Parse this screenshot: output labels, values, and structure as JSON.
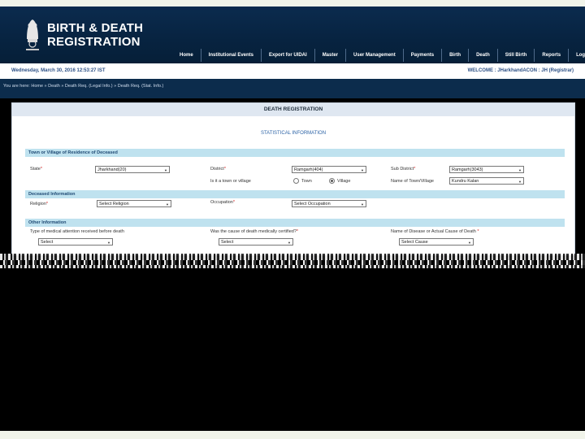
{
  "brand": {
    "line1": "BIRTH & DEATH",
    "line2": "REGISTRATION"
  },
  "nav": [
    "Home",
    "Institutional Events",
    "Export for UIDAI",
    "Master",
    "User Management",
    "Payments",
    "Birth",
    "Death",
    "Still Birth",
    "Reports",
    "Logout"
  ],
  "infobar": {
    "date": "Wednesday, March 30, 2016 12:53:27 IST",
    "welcome": "WELCOME : JHarkhandACON : JH     (Registrar)"
  },
  "breadcrumb": "You are here:  Home  » Death »  Death Req. (Legal Info.)  » Death Req. (Stat. Info.)",
  "form": {
    "title": "DEATH REGISTRATION",
    "subtitle": "STATISTICAL INFORMATION",
    "sections": {
      "residence": "Town or Village of Residence of Deceased",
      "deceased": "Deceased Information",
      "other": "Other Information"
    },
    "labels": {
      "state": "State",
      "district": "District",
      "sub_district": "Sub District",
      "town_or_village": "Is it a town or village",
      "town": "Town",
      "village": "Village",
      "name_town": "Name of Town/Village",
      "religion": "Religion",
      "occupation": "Occupation",
      "medical_attention": "Type of medical attention received before death",
      "certified": "Was the cause of death medically certified?",
      "disease": "Name of Disease or Actual Cause of Death"
    },
    "required_mark": "*",
    "values": {
      "state": "Jharkhand(20)",
      "district": "Ramgarh(404)",
      "sub_district": "Ramgarh(3043)",
      "name_town": "Kundru Kalan",
      "religion": "Select Religion",
      "occupation": "Select Occupation",
      "medical_attention": "Select",
      "certified": "Select",
      "disease": "Select Cause"
    },
    "village_selected": true
  }
}
